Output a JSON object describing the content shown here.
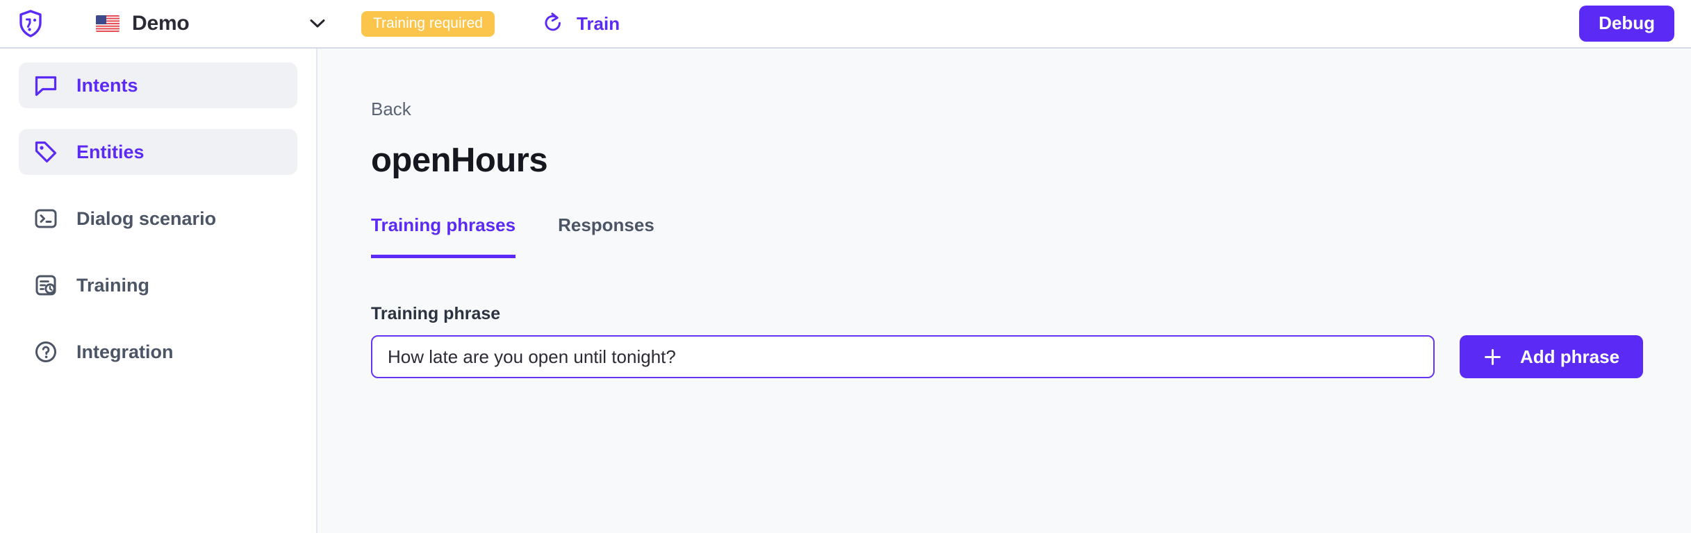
{
  "topbar": {
    "logo_icon": "shield-face-logo-icon",
    "project": {
      "flag_icon": "us-flag-icon",
      "name": "Demo",
      "chevron_icon": "chevron-down-icon"
    },
    "status_badge": "Training required",
    "train": {
      "icon": "refresh-ccw-icon",
      "label": "Train"
    },
    "debug_label": "Debug"
  },
  "sidebar": {
    "items": [
      {
        "label": "Intents",
        "icon": "speech-bubble-icon",
        "active": true
      },
      {
        "label": "Entities",
        "icon": "tag-icon",
        "active": true
      },
      {
        "label": "Dialog scenario",
        "icon": "terminal-icon",
        "active": false
      },
      {
        "label": "Training",
        "icon": "file-clock-icon",
        "active": false
      },
      {
        "label": "Integration",
        "icon": "question-circle-icon",
        "active": false
      }
    ]
  },
  "main": {
    "back_label": "Back",
    "title": "openHours",
    "tabs": [
      {
        "label": "Training phrases",
        "active": true
      },
      {
        "label": "Responses",
        "active": false
      }
    ],
    "form": {
      "field_label": "Training phrase",
      "input_value": "How late are you open until tonight?",
      "input_placeholder": "Training phrase",
      "add_button_label": "Add phrase",
      "add_button_icon": "plus-icon"
    }
  },
  "colors": {
    "accent": "#5b2bf5",
    "warning": "#fbc54c",
    "text": "#4c5566",
    "main_bg": "#f8f9fb"
  }
}
